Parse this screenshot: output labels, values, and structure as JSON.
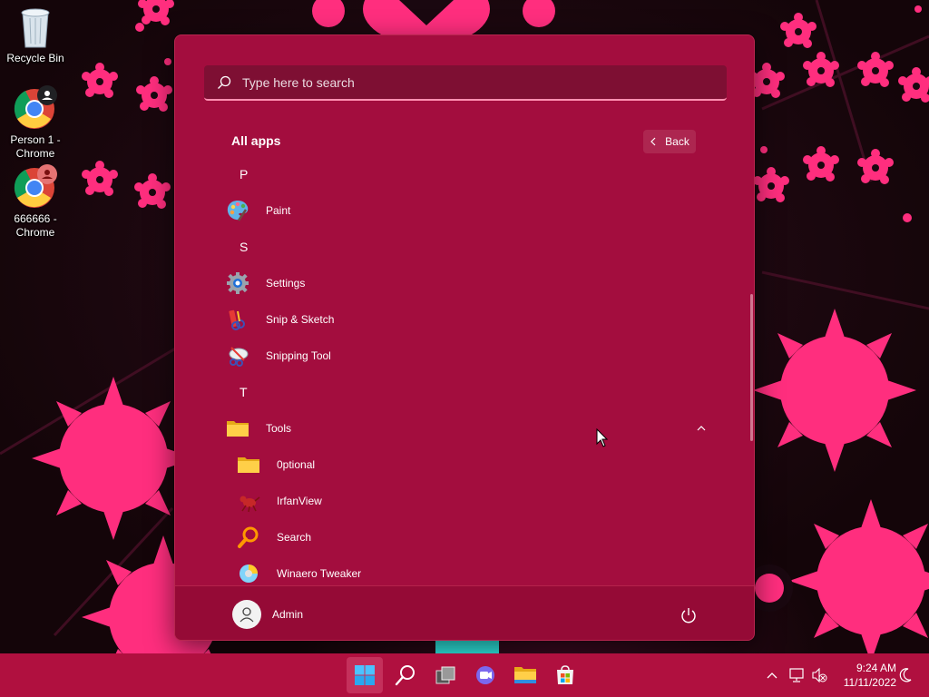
{
  "desktop": {
    "icons": [
      {
        "label": "Recycle Bin",
        "icon": "recycle-bin-icon"
      },
      {
        "label": "Person 1 - Chrome",
        "icon": "chrome-icon"
      },
      {
        "label": "666666 - Chrome",
        "icon": "chrome-icon"
      }
    ]
  },
  "start_menu": {
    "search": {
      "placeholder": "Type here to search"
    },
    "all_apps_title": "All apps",
    "back_label": "Back",
    "sections": [
      {
        "letter": "P",
        "apps": [
          {
            "name": "Paint",
            "icon": "paint-icon"
          }
        ]
      },
      {
        "letter": "S",
        "apps": [
          {
            "name": "Settings",
            "icon": "gear-icon"
          },
          {
            "name": "Snip & Sketch",
            "icon": "snip-sketch-icon"
          },
          {
            "name": "Snipping Tool",
            "icon": "snipping-tool-icon"
          }
        ]
      },
      {
        "letter": "T",
        "apps": [
          {
            "name": "Tools",
            "icon": "folder-icon",
            "expanded": true,
            "children": [
              {
                "name": "0ptional",
                "icon": "folder-icon"
              },
              {
                "name": "IrfanView",
                "icon": "irfanview-icon"
              },
              {
                "name": "Search",
                "icon": "search-icon"
              },
              {
                "name": "Winaero Tweaker",
                "icon": "winaero-icon"
              }
            ]
          }
        ]
      }
    ],
    "user": {
      "name": "Admin",
      "icon": "user-icon"
    },
    "power_icon": "power-icon"
  },
  "taskbar": {
    "buttons": [
      "windows-start-icon",
      "search-icon",
      "task-view-icon",
      "chat-icon",
      "file-explorer-icon",
      "store-icon"
    ],
    "tray": {
      "chevron": "chevron-up-icon",
      "network": "network-icon",
      "volume": "volume-muted-icon",
      "time": "9:24 AM",
      "date": "11/11/2022",
      "focus": "moon-icon"
    }
  },
  "colors": {
    "start_bg": "#a30d3e",
    "taskbar_bg": "#b0103f",
    "accent": "#ff8fb1"
  }
}
